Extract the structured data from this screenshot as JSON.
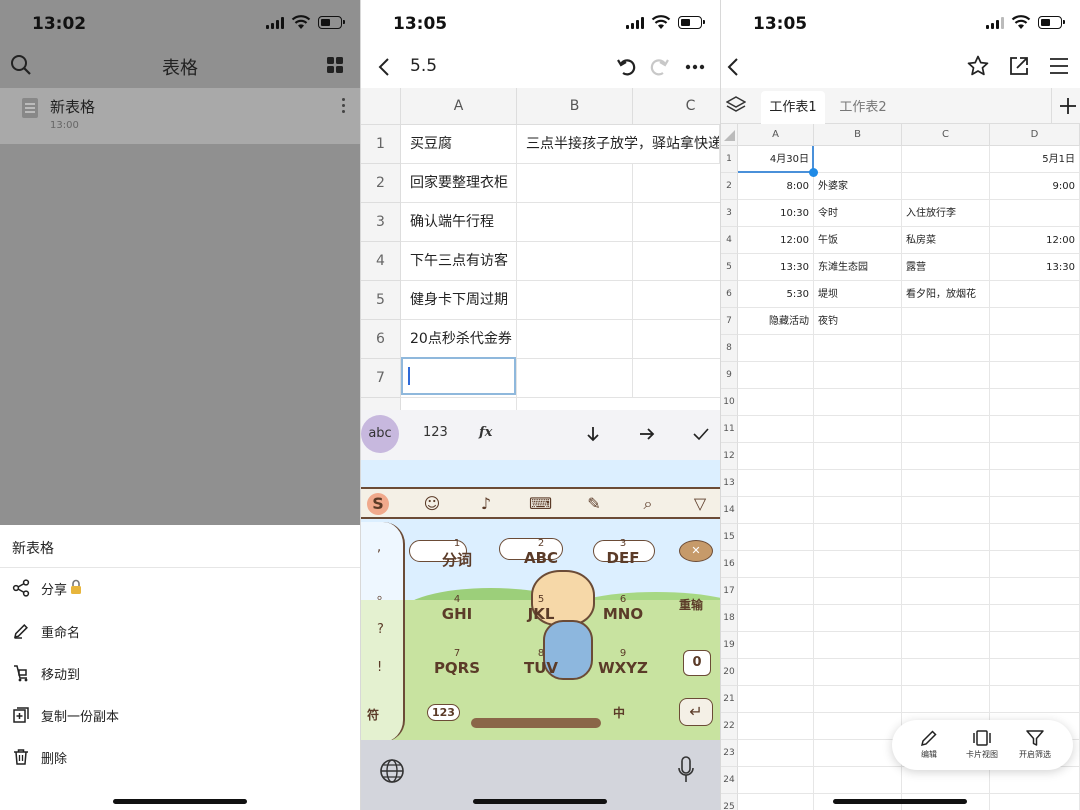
{
  "panel1": {
    "status_time": "13:02",
    "header_title": "表格",
    "file": {
      "name": "新表格",
      "time": "13:00"
    },
    "sheet_title": "新表格",
    "menu": [
      {
        "label": "分享",
        "icon": "share-icon"
      },
      {
        "label": "重命名",
        "icon": "pencil-icon"
      },
      {
        "label": "移动到",
        "icon": "move-icon"
      },
      {
        "label": "复制一份副本",
        "icon": "copy-icon"
      },
      {
        "label": "删除",
        "icon": "trash-icon"
      }
    ]
  },
  "panel2": {
    "status_time": "13:05",
    "doc_title": "5.5",
    "columns": [
      "A",
      "B",
      "C"
    ],
    "rows": [
      {
        "num": "1",
        "a": "买豆腐",
        "b": "三点半接孩子放学，驿站拿快递"
      },
      {
        "num": "2",
        "a": "回家要整理衣柜",
        "b": ""
      },
      {
        "num": "3",
        "a": "确认端午行程",
        "b": ""
      },
      {
        "num": "4",
        "a": "下午三点有访客",
        "b": ""
      },
      {
        "num": "5",
        "a": "健身卡下周过期",
        "b": ""
      },
      {
        "num": "6",
        "a": "20点秒杀代金券",
        "b": ""
      },
      {
        "num": "7",
        "a": "",
        "b": ""
      }
    ],
    "kb_toolbar": {
      "abc": "abc",
      "num": "123",
      "fx": "fx"
    },
    "keyboard": {
      "keys": [
        {
          "num": "1",
          "label": "分词"
        },
        {
          "num": "2",
          "label": "ABC"
        },
        {
          "num": "3",
          "label": "DEF"
        },
        {
          "num": "4",
          "label": "GHI"
        },
        {
          "num": "5",
          "label": "JKL"
        },
        {
          "num": "6",
          "label": "MNO"
        },
        {
          "num": "7",
          "label": "PQRS"
        },
        {
          "num": "8",
          "label": "TUV"
        },
        {
          "num": "9",
          "label": "WXYZ"
        }
      ],
      "reenter": "重输",
      "zero": "0",
      "symbol": "符",
      "num123": "123",
      "lang": "中",
      "side_keys": [
        ",",
        "。",
        "?",
        "!"
      ]
    }
  },
  "panel3": {
    "status_time": "13:05",
    "tabs": [
      "工作表1",
      "工作表2"
    ],
    "columns": [
      "A",
      "B",
      "C",
      "D"
    ],
    "rows": [
      {
        "num": "1",
        "a": "4月30日",
        "b": "",
        "c": "",
        "d": "5月1日"
      },
      {
        "num": "2",
        "a": "8:00",
        "b": "外婆家",
        "c": "",
        "d": "9:00"
      },
      {
        "num": "3",
        "a": "10:30",
        "b": "令时",
        "c": "入住放行李",
        "d": ""
      },
      {
        "num": "4",
        "a": "12:00",
        "b": "午饭",
        "c": "私房菜",
        "d": "12:00"
      },
      {
        "num": "5",
        "a": "13:30",
        "b": "东滩生态园",
        "c": "露营",
        "d": "13:30"
      },
      {
        "num": "6",
        "a": "5:30",
        "b": "堤坝",
        "c": "看夕阳，放烟花",
        "d": ""
      },
      {
        "num": "7",
        "a": "隐藏活动",
        "b": "夜钓",
        "c": "",
        "d": ""
      },
      {
        "num": "8"
      },
      {
        "num": "9"
      },
      {
        "num": "10"
      },
      {
        "num": "11"
      },
      {
        "num": "12"
      },
      {
        "num": "13"
      },
      {
        "num": "14"
      },
      {
        "num": "15"
      },
      {
        "num": "16"
      },
      {
        "num": "17"
      },
      {
        "num": "18"
      },
      {
        "num": "19"
      },
      {
        "num": "20"
      },
      {
        "num": "21"
      },
      {
        "num": "22"
      },
      {
        "num": "23"
      },
      {
        "num": "24"
      },
      {
        "num": "25"
      }
    ],
    "toolbar": [
      {
        "label": "编辑",
        "icon": "pencil-icon"
      },
      {
        "label": "卡片视图",
        "icon": "card-view-icon"
      },
      {
        "label": "开启筛选",
        "icon": "filter-icon"
      }
    ]
  }
}
